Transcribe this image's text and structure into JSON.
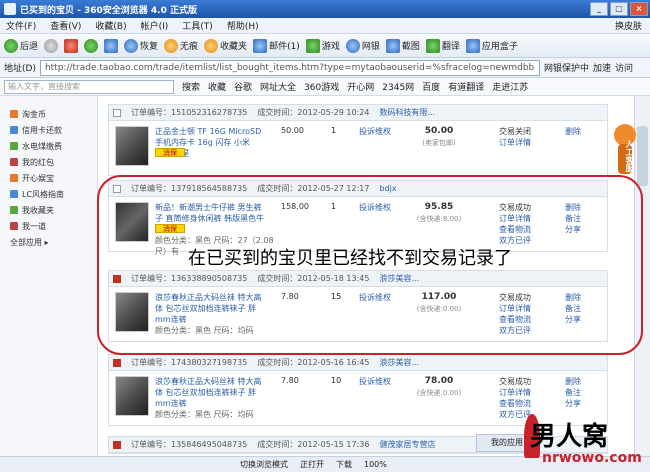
{
  "window": {
    "title": "已买到的宝贝 - 360安全浏览器 4.0 正式版"
  },
  "menu": {
    "items": [
      "文件(F)",
      "查看(V)",
      "收藏(B)",
      "帐户(I)",
      "工具(T)",
      "帮助(H)"
    ],
    "skin": "换皮肤"
  },
  "toolbar": {
    "back": "后退",
    "restore": "恢复",
    "noimg": "无痕",
    "favorite": "收藏夹",
    "mail": "邮件(1)",
    "game": "游戏",
    "netbank": "网银",
    "shot": "截图",
    "translate": "翻译",
    "appbox": "应用盒子"
  },
  "address": {
    "label": "地址(D)",
    "url": "http://trade.taobao.com/trade/itemlist/list_bought_items.htm?type=mytaobaouserid=%sfracelog=newmdbb",
    "net_protect": "网银保护中",
    "speed": "加速",
    "go": "访问"
  },
  "favbar": {
    "search_placeholder": "输入文字，直接搜索",
    "items": [
      "搜索",
      "收藏",
      "谷歌",
      "网址大全",
      "360游戏",
      "开心网",
      "2345网",
      "百度",
      "有道翻译",
      "走进江苏"
    ]
  },
  "sidebar": {
    "items": [
      "淘金币",
      "信用卡还款",
      "水电煤缴费",
      "我的红包",
      "开心娱宝",
      "LC风格指南",
      "我收藏夹",
      "我一道"
    ],
    "all": "全部应用 ▸"
  },
  "orders": [
    {
      "order_no": "订单编号：151052316278735",
      "time": "成交时间：2012-05-29 10:24",
      "seller": "数码科技有限...",
      "name": "正品金士顿 TF 16G MicroSD 手机内存卡 16g 闪存 小米 HTC 三星",
      "guarantee": "消保",
      "props": "",
      "price": "50.00",
      "qty": "1",
      "after": "投诉维权",
      "total": "50.00",
      "total_sub": "(卖家包邮)",
      "status": [
        "交易关闭",
        "订单详情"
      ],
      "ops": [
        "删除"
      ]
    },
    {
      "order_no": "订单编号：137918564588735",
      "time": "成交时间：2012-05-27 12:17",
      "seller": "bdjx",
      "name": "新品！新潮男士牛仔裤 男生裤子 直筒修身休闲裤 韩版黑色牛仔裤",
      "guarantee": "消保",
      "props": "颜色分类：黑色 尺码：27（2.08尺）有",
      "price": "158.00",
      "qty": "1",
      "after": "投诉维权",
      "total": "95.85",
      "total_sub": "(含快递:8.00)",
      "status": [
        "交易成功",
        "订单详情",
        "查看物流",
        "双方已评"
      ],
      "ops": [
        "删除",
        "备注",
        "分享"
      ]
    },
    {
      "order_no": "订单编号：136338890508735",
      "time": "成交时间：2012-05-18 13:45",
      "seller": "浪莎美容...",
      "name": "浪莎春秋正品大码丝袜 特大高体 包芯丝双加档连裤袜子 胖mm连裤",
      "guarantee": "",
      "props": "颜色分类：黑色 尺码：均码",
      "price": "7.80",
      "qty": "15",
      "after": "投诉维权",
      "total": "117.00",
      "total_sub": "(含快递:0.00)",
      "status": [
        "交易成功",
        "订单详情",
        "查看物流",
        "双方已评"
      ],
      "ops": [
        "删除",
        "备注",
        "分享"
      ]
    },
    {
      "order_no": "订单编号：174380327198735",
      "time": "成交时间：2012-05-16 16:45",
      "seller": "浪莎美容...",
      "name": "浪莎春秋正品大码丝袜 特大高体 包芯丝双加档连裤袜子 胖mm连裤",
      "guarantee": "",
      "props": "颜色分类：黑色 尺码：均码",
      "price": "7.80",
      "qty": "10",
      "after": "投诉维权",
      "total": "78.00",
      "total_sub": "(含快递:0.00)",
      "status": [
        "交易成功",
        "订单详情",
        "查看物流",
        "双方已评"
      ],
      "ops": [
        "删除",
        "备注",
        "分享"
      ]
    },
    {
      "order_no": "订单编号：135846495048735",
      "time": "成交时间：2012-05-15 17:36",
      "seller": "健茂家居专营店",
      "name": "",
      "guarantee": "",
      "props": "",
      "price": "",
      "qty": "",
      "after": "",
      "total": "",
      "total_sub": "",
      "status": [],
      "ops": []
    }
  ],
  "overlay_text": "在已买到的宝贝里已经找不到交易记录了",
  "mascot_label": "人工客服",
  "myapp_tab": "我的应用",
  "statusbar": {
    "items": [
      "切换浏览模式",
      "正打开",
      "下载",
      "100%"
    ]
  },
  "watermark": {
    "brand": "男人窝",
    "url": "nrwowo.com"
  }
}
